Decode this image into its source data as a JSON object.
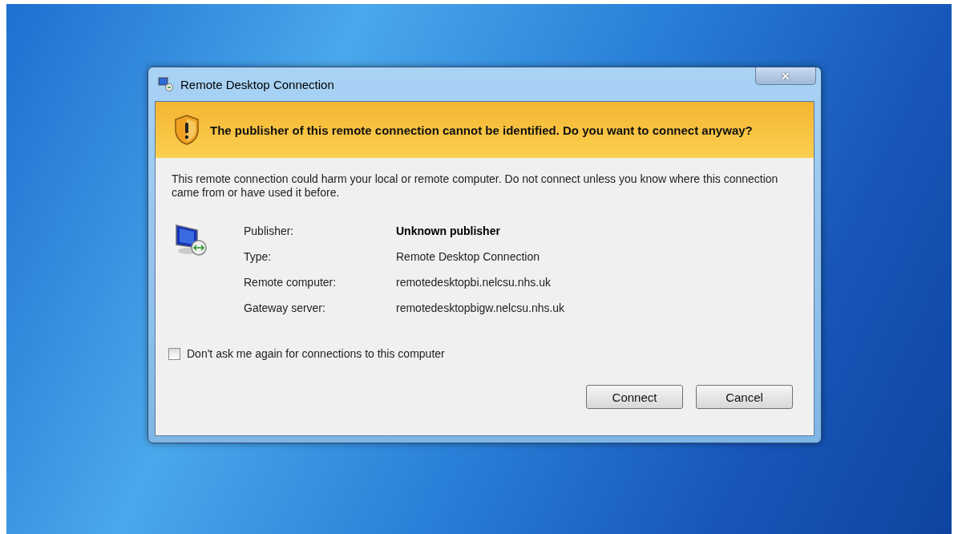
{
  "window": {
    "title": "Remote Desktop Connection",
    "close_label": "✕"
  },
  "banner": {
    "text": "The publisher of this remote connection cannot be identified. Do you want to connect anyway?"
  },
  "message": "This remote connection could harm your local or remote computer. Do not connect unless you know where this connection came from or have used it before.",
  "details": [
    {
      "label": "Publisher:",
      "value": "Unknown publisher",
      "bold": true
    },
    {
      "label": "Type:",
      "value": "Remote Desktop Connection",
      "bold": false
    },
    {
      "label": "Remote computer:",
      "value": "remotedesktopbi.nelcsu.nhs.uk",
      "bold": false
    },
    {
      "label": "Gateway server:",
      "value": "remotedesktopbigw.nelcsu.nhs.uk",
      "bold": false
    }
  ],
  "checkbox": {
    "label": "Don't ask me again for connections to this computer",
    "checked": false
  },
  "buttons": [
    "Connect",
    "Cancel"
  ]
}
